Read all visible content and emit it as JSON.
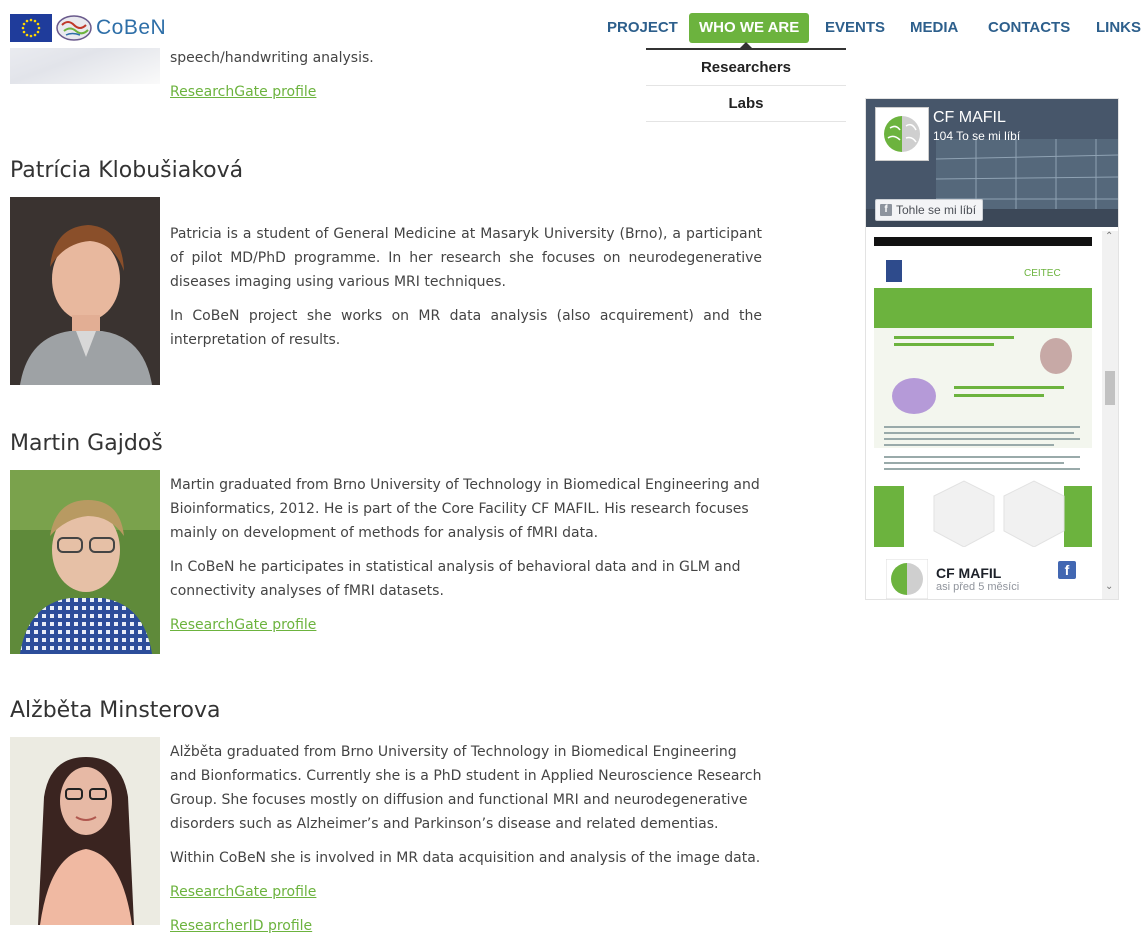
{
  "brand": {
    "name": "CoBeN"
  },
  "nav": {
    "items": [
      {
        "label": "PROJECT"
      },
      {
        "label": "WHO WE ARE"
      },
      {
        "label": "EVENTS"
      },
      {
        "label": "MEDIA"
      },
      {
        "label": "CONTACTS"
      },
      {
        "label": "LINKS"
      }
    ],
    "active": "WHO WE ARE",
    "dropdown": [
      {
        "label": "Researchers"
      },
      {
        "label": "Labs"
      }
    ]
  },
  "top_fragment": {
    "text": "speech/handwriting analysis.",
    "link": "ResearchGate profile"
  },
  "people": [
    {
      "name": "Patrícia Klobušiaková",
      "paragraphs": [
        "Patricia is a student of General Medicine at Masaryk University (Brno), a participant of pilot MD/PhD programme. In her research she focuses on neurodegenerative diseases imaging using various MRI techniques.",
        "In CoBeN project she works on MR data analysis (also acquirement) and the interpretation of results."
      ],
      "links": []
    },
    {
      "name": "Martin Gajdoš",
      "paragraphs": [
        "Martin graduated from Brno University of Technology in Biomedical Engineering and Bioinformatics, 2012. He is part of the Core Facility CF MAFIL. His research focuses mainly on development of methods for analysis of fMRI data.",
        "In CoBeN he participates in statistical analysis of behavioral data and in GLM and connectivity  analyses of fMRI datasets."
      ],
      "links": [
        "ResearchGate profile"
      ]
    },
    {
      "name": "Alžběta Minsterova",
      "paragraphs": [
        "Alžběta graduated from Brno University of Technology in Biomedical Engineering and Bionformatics. Currently she is a PhD student in Applied Neuroscience Research Group. She focuses mostly on diffusion and functional MRI and neurodegenerative disorders such as Alzheimer’s and Parkinson’s disease and related dementias.",
        "Within CoBeN she is involved in MR data acquisition and analysis of the image data."
      ],
      "links": [
        "ResearchGate profile",
        "ResearcherID profile"
      ]
    }
  ],
  "facebook": {
    "page_name": "CF MAFIL",
    "likes": "104 To se mi líbí",
    "like_button": "Tohle se mi líbí",
    "post_author": "CF MAFIL",
    "post_time": "asi před 5 měsíci",
    "post_header": "CEITEC"
  },
  "colors": {
    "accent_green": "#6cb33e",
    "nav_blue": "#2d5f8c",
    "facebook_blue": "#4267b2"
  }
}
